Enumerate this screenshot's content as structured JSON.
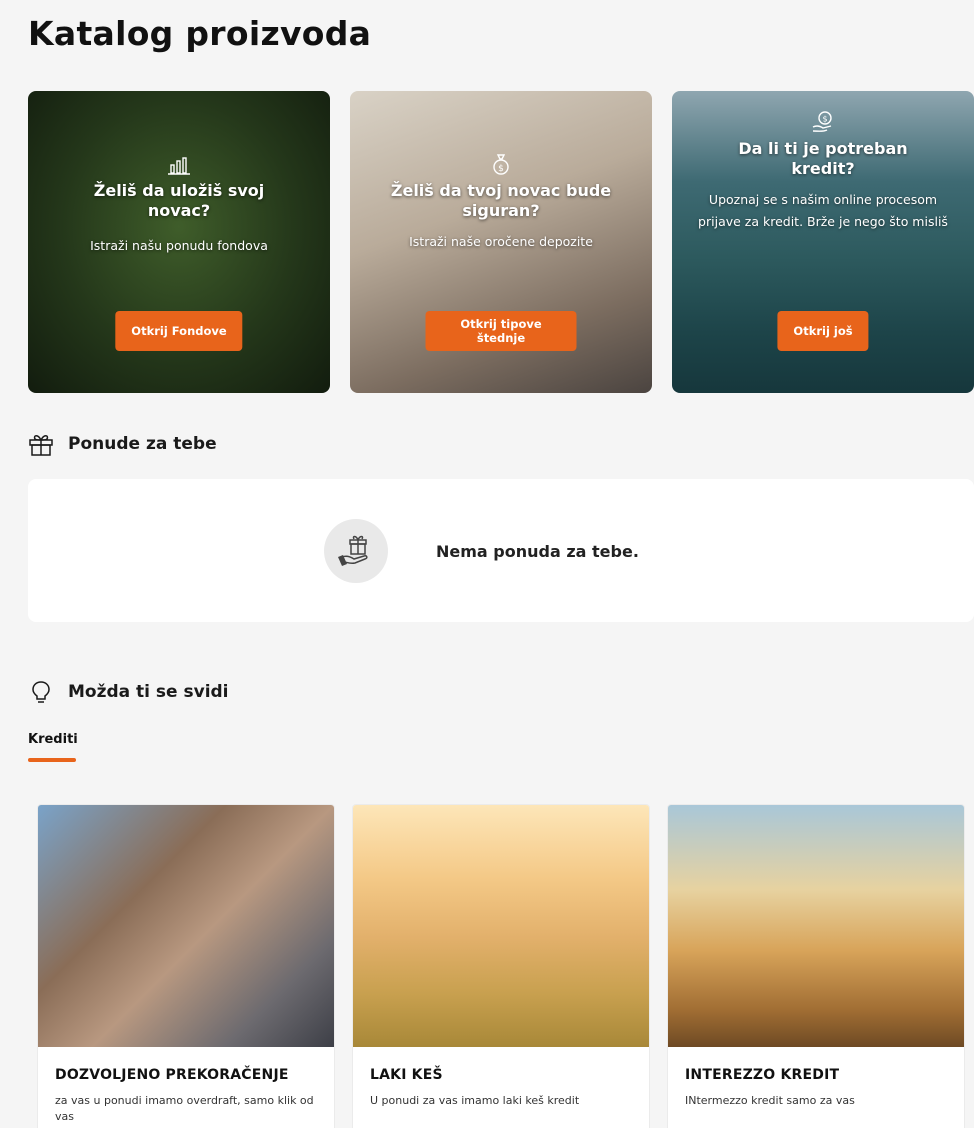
{
  "page": {
    "title": "Katalog proizvoda"
  },
  "promos": [
    {
      "icon": "bar-chart-icon",
      "title": "Želiš da uložiš svoj novac?",
      "text": "Istraži našu ponudu fondova",
      "button": "Otkrij Fondove"
    },
    {
      "icon": "money-bag-icon",
      "title": "Želiš da tvoj novac bude siguran?",
      "text": "Istraži naše oročene depozite",
      "button": "Otkrij tipove štednje"
    },
    {
      "icon": "hand-coin-icon",
      "title": "Da li ti je potreban kredit?",
      "text": "Upoznaj se s našim online procesom prijave za kredit. Brže je nego što misliš",
      "button": "Otkrij još"
    }
  ],
  "offers": {
    "title": "Ponude za tebe",
    "icon": "gift-icon",
    "empty_icon": "gift-hand-icon",
    "empty_text": "Nema ponuda za tebe."
  },
  "suggestions": {
    "title": "Možda ti se svidi",
    "icon": "lightbulb-icon",
    "tab": "Krediti",
    "products": [
      {
        "name": "DOZVOLJENO PREKORAČENJE",
        "desc": "za vas u ponudi imamo overdraft, samo klik od vas"
      },
      {
        "name": "LAKI KEŠ",
        "desc": "U ponudi za vas imamo laki keš kredit"
      },
      {
        "name": "INTEREZZO KREDIT",
        "desc": "INtermezzo kredit samo za vas"
      }
    ]
  },
  "colors": {
    "accent": "#e8641b",
    "background": "#f5f5f5",
    "card": "#ffffff"
  }
}
